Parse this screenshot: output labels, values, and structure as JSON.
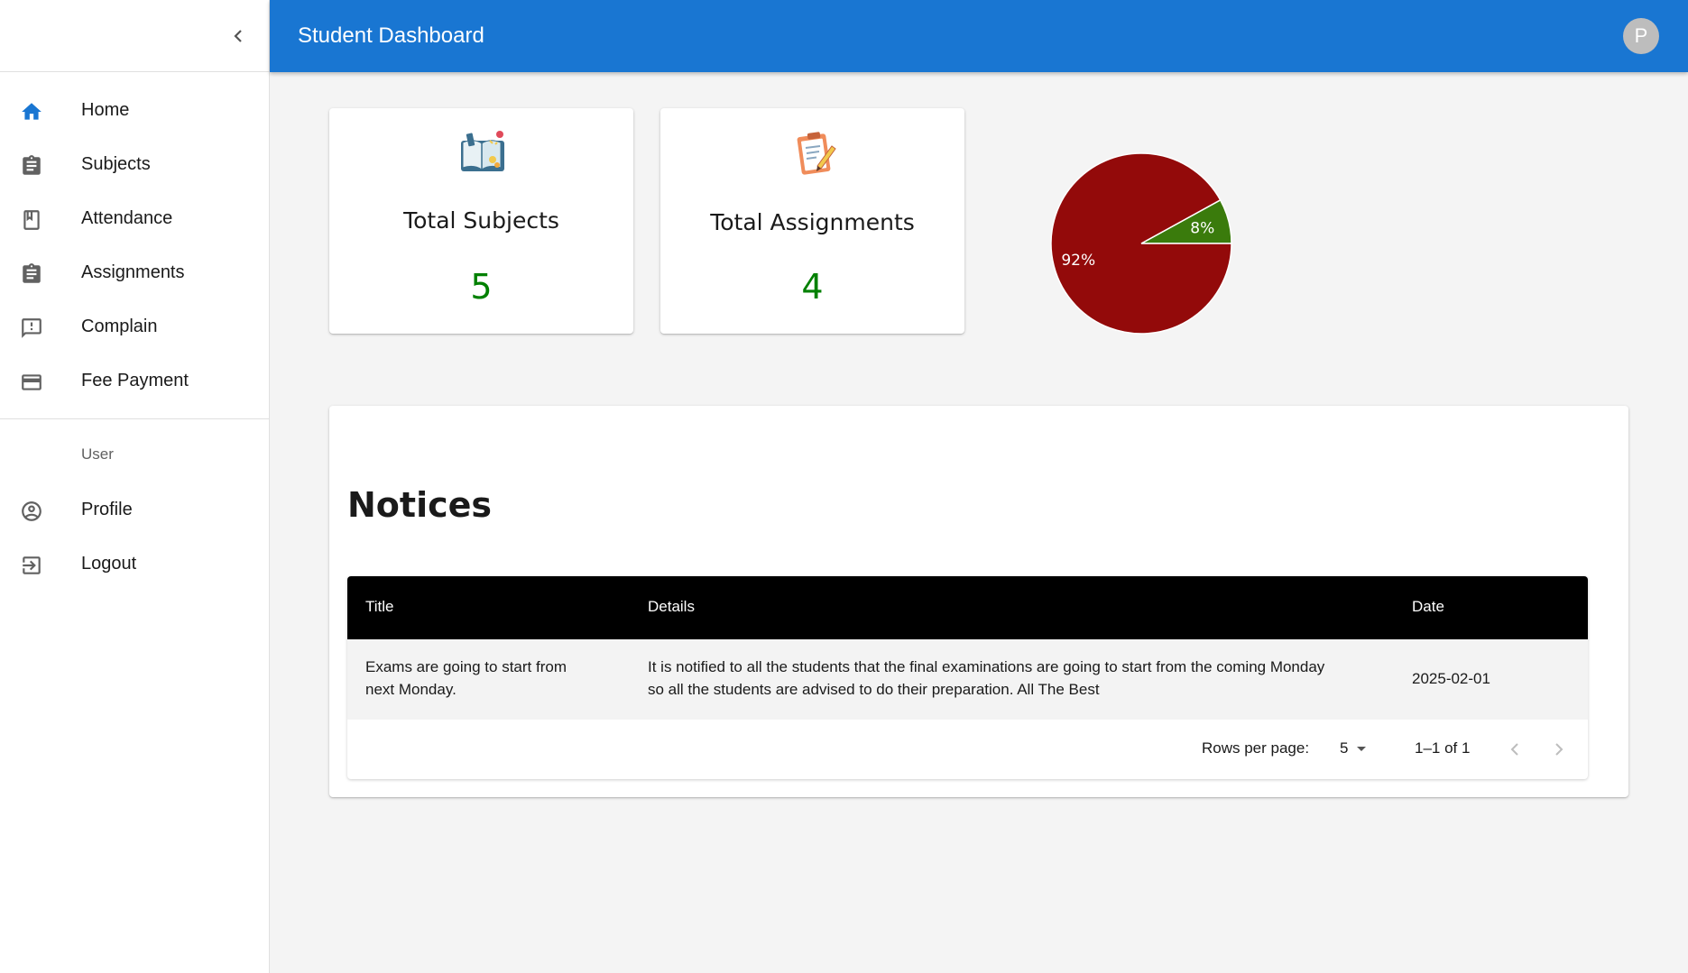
{
  "app": {
    "title": "Student Dashboard",
    "avatar_initial": "P",
    "accent_color": "#1976d2"
  },
  "sidebar": {
    "collapse_icon": "chevron-left-icon",
    "items": [
      {
        "label": "Home",
        "icon": "home-icon",
        "active": true
      },
      {
        "label": "Subjects",
        "icon": "clipboard-icon"
      },
      {
        "label": "Attendance",
        "icon": "bookmark-icon"
      },
      {
        "label": "Assignments",
        "icon": "clipboard-icon"
      },
      {
        "label": "Complain",
        "icon": "feedback-icon"
      },
      {
        "label": "Fee Payment",
        "icon": "credit-card-icon"
      }
    ],
    "section_header": "User",
    "user_items": [
      {
        "label": "Profile",
        "icon": "account-circle-icon"
      },
      {
        "label": "Logout",
        "icon": "logout-icon"
      }
    ]
  },
  "stats": {
    "subjects": {
      "title": "Total Subjects",
      "value": "5",
      "icon": "open-book-icon"
    },
    "assignments": {
      "title": "Total Assignments",
      "value": "4",
      "icon": "clipboard-pencil-icon"
    }
  },
  "chart_data": {
    "type": "pie",
    "slices": [
      {
        "label": "92%",
        "value": 92,
        "color": "#930a0a"
      },
      {
        "label": "8%",
        "value": 8,
        "color": "#3a7b0c"
      }
    ]
  },
  "notices": {
    "title": "Notices",
    "columns": [
      "Title",
      "Details",
      "Date"
    ],
    "rows": [
      {
        "title_line1": "Exams are going to start from",
        "title_line2": "next Monday.",
        "details_line1": "It is notified to all the students that the final examinations are going to start from the coming Monday",
        "details_line2": "so all the students are advised to do their preparation. All The Best",
        "date": "2025-02-01"
      }
    ],
    "pagination": {
      "rows_per_page_label": "Rows per page:",
      "rows_per_page_value": "5",
      "range": "1–1 of 1"
    }
  }
}
